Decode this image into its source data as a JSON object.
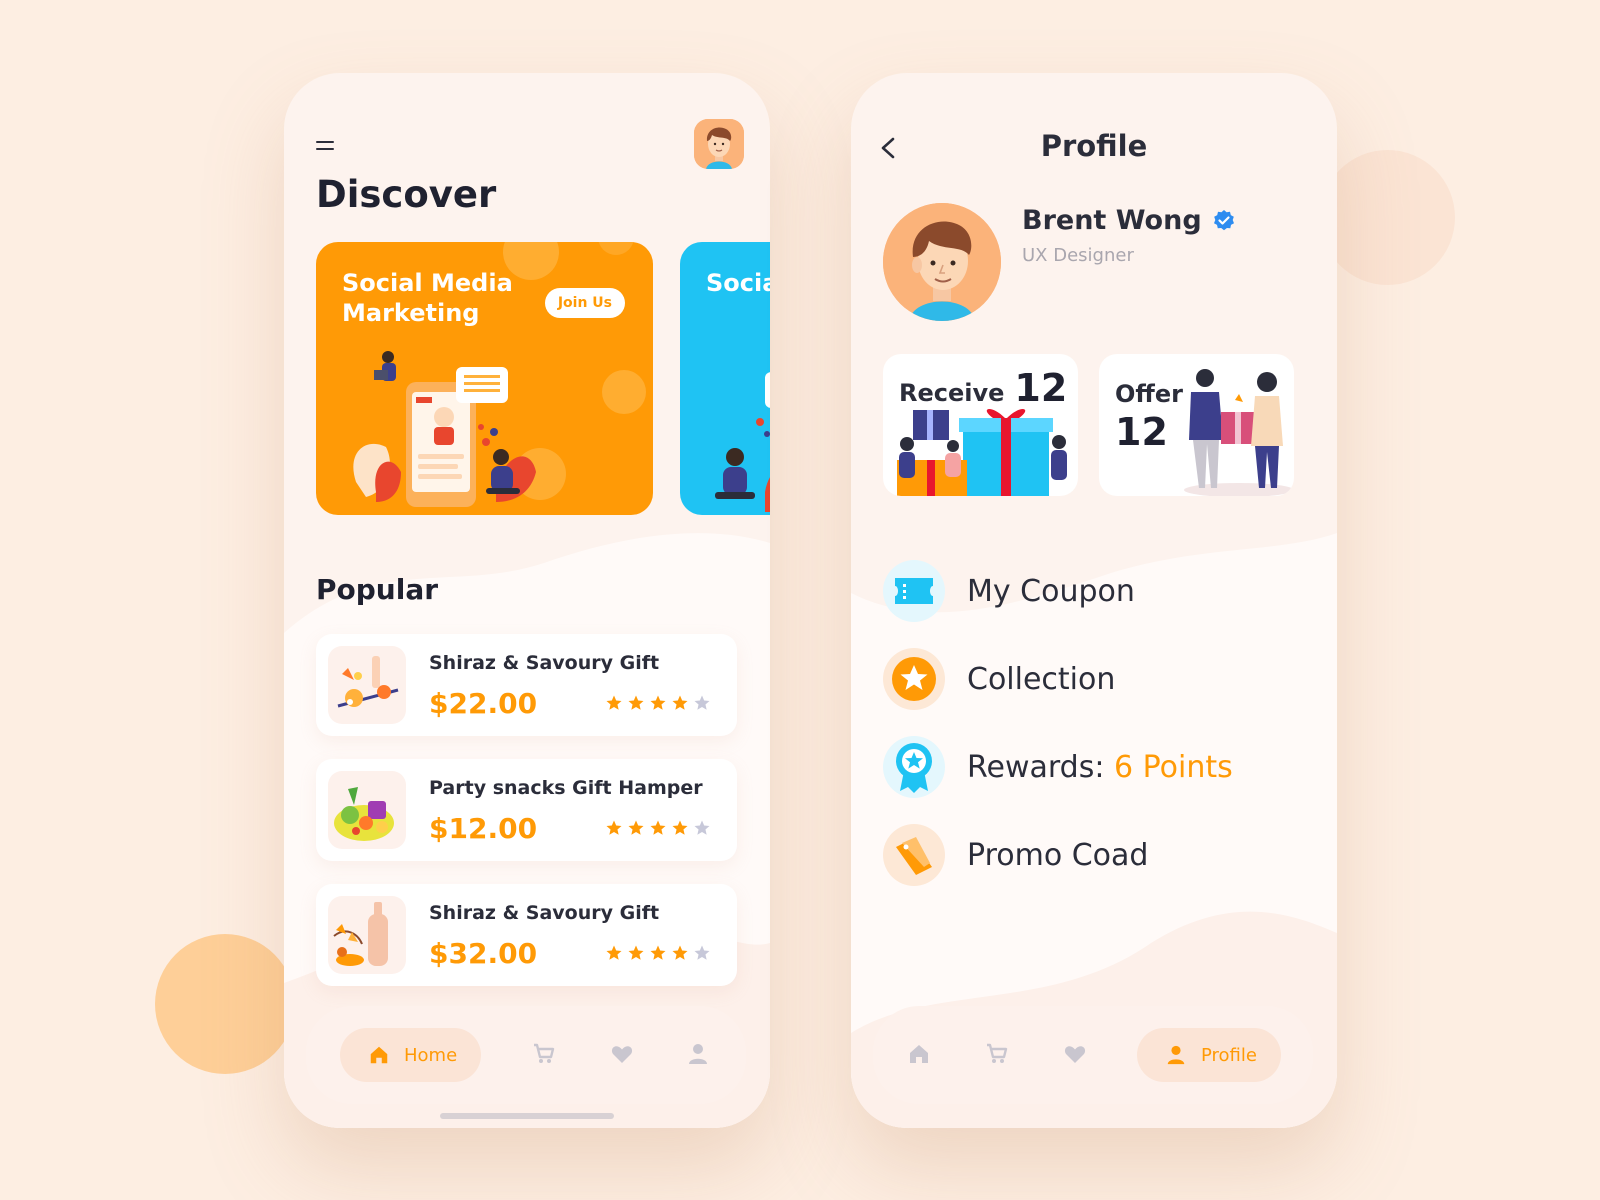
{
  "colors": {
    "accent": "#ff9a06",
    "blue": "#1fc3f3",
    "background": "#fdeee2",
    "star_inactive": "#c7c8d9"
  },
  "discover": {
    "title": "Discover",
    "banners": [
      {
        "title": "Social Media Marketing",
        "button": "Join Us",
        "color": "#ff9a06"
      },
      {
        "title": "Social Media Marketing",
        "color": "#1fc3f3"
      }
    ],
    "popular_title": "Popular",
    "items": [
      {
        "name": "Shiraz & Savoury Gift",
        "price": "$22.00",
        "rating": 4,
        "max_rating": 5
      },
      {
        "name": "Party snacks Gift Hamper",
        "price": "$12.00",
        "rating": 4,
        "max_rating": 5
      },
      {
        "name": "Shiraz & Savoury Gift",
        "price": "$32.00",
        "rating": 4,
        "max_rating": 5
      }
    ],
    "nav": {
      "active_label": "Home",
      "icons": [
        "home-icon",
        "cart-icon",
        "heart-icon",
        "user-icon"
      ]
    }
  },
  "profile": {
    "title": "Profile",
    "name": "Brent Wong",
    "role": "UX Designer",
    "stats": {
      "receive_label": "Receive",
      "receive_value": "12",
      "offer_label": "Offer",
      "offer_value": "12"
    },
    "menu": {
      "coupon": "My Coupon",
      "collection": "Collection",
      "rewards_label": "Rewards:",
      "rewards_value": "6 Points",
      "promo": "Promo Coad"
    },
    "nav": {
      "active_label": "Profile",
      "icons": [
        "home-icon",
        "cart-icon",
        "heart-icon",
        "user-icon"
      ]
    }
  }
}
